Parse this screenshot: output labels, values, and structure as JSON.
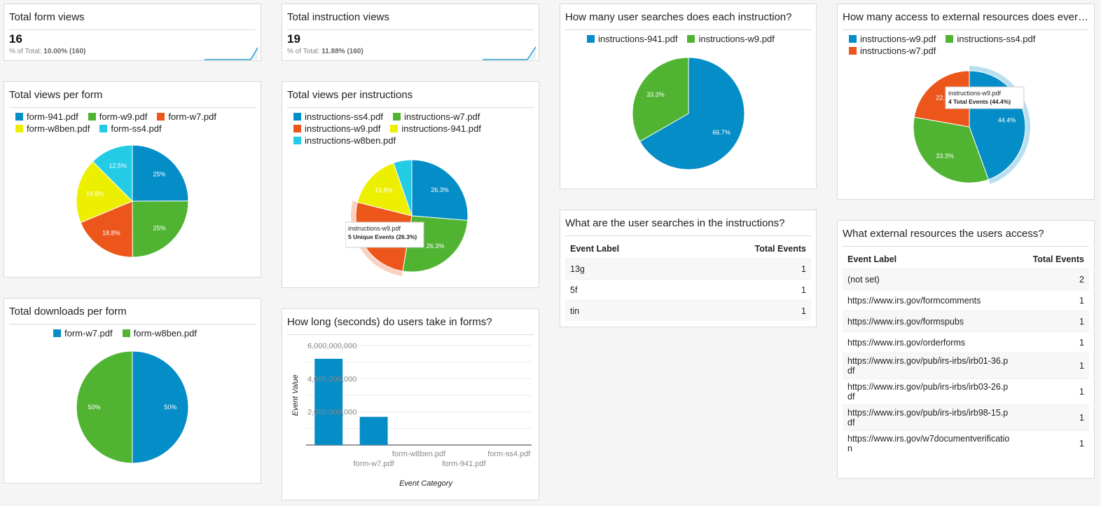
{
  "colors": {
    "blue": "#058dc7",
    "green": "#50b432",
    "orange": "#ed561b",
    "yellow": "#edef00",
    "cyan": "#24cbe5"
  },
  "cards": {
    "form_views": {
      "title": "Total form views",
      "value": "16",
      "pct_label": "% of Total:",
      "pct_value": "10.00% (160)"
    },
    "instruction_views": {
      "title": "Total instruction views",
      "value": "19",
      "pct_label": "% of Total:",
      "pct_value": "11.88% (160)"
    },
    "views_per_form": {
      "title": "Total views per form"
    },
    "views_per_instructions": {
      "title": "Total views per instructions"
    },
    "downloads_per_form": {
      "title": "Total downloads per form"
    },
    "time_in_forms": {
      "title": "How long (seconds) do users take in forms?"
    },
    "searches_per_instruction": {
      "title": "How many user searches does each instruction?"
    },
    "searches_table": {
      "title": "What are the user searches in the instructions?"
    },
    "external_per": {
      "title": "How many access to external resources does every..."
    },
    "external_table": {
      "title": "What external resources the users access?"
    }
  },
  "chart_data": [
    {
      "type": "pie",
      "id": "views_per_form",
      "series": [
        {
          "name": "form-941.pdf",
          "value": 25,
          "label": "25%",
          "color": "#058dc7"
        },
        {
          "name": "form-w9.pdf",
          "value": 25,
          "label": "25%",
          "color": "#50b432"
        },
        {
          "name": "form-w7.pdf",
          "value": 18.8,
          "label": "18.8%",
          "color": "#ed561b"
        },
        {
          "name": "form-w8ben.pdf",
          "value": 18.8,
          "label": "18.8%",
          "color": "#edef00"
        },
        {
          "name": "form-ss4.pdf",
          "value": 12.5,
          "label": "12.5%",
          "color": "#24cbe5"
        }
      ]
    },
    {
      "type": "pie",
      "id": "views_per_instructions",
      "series": [
        {
          "name": "instructions-ss4.pdf",
          "value": 26.3,
          "label": "26.3%",
          "color": "#058dc7"
        },
        {
          "name": "instructions-w7.pdf",
          "value": 26.3,
          "label": "26.3%",
          "color": "#50b432"
        },
        {
          "name": "instructions-w9.pdf",
          "value": 26.3,
          "label": "",
          "color": "#ed561b"
        },
        {
          "name": "instructions-941.pdf",
          "value": 15.8,
          "label": "15.8%",
          "color": "#edef00"
        },
        {
          "name": "instructions-w8ben.pdf",
          "value": 5.3,
          "label": "",
          "color": "#24cbe5"
        }
      ],
      "tooltip": {
        "title": "instructions-w9.pdf",
        "text": "5 Unique Events (26.3%)"
      }
    },
    {
      "type": "pie",
      "id": "downloads_per_form",
      "series": [
        {
          "name": "form-w7.pdf",
          "value": 50,
          "label": "50%",
          "color": "#058dc7"
        },
        {
          "name": "form-w8ben.pdf",
          "value": 50,
          "label": "50%",
          "color": "#50b432"
        }
      ]
    },
    {
      "type": "bar",
      "id": "time_in_forms",
      "categories": [
        "",
        "form-w7.pdf",
        "form-w8ben.pdf",
        "form-941.pdf",
        "form-ss4.pdf"
      ],
      "values": [
        5200000000,
        1700000000,
        0,
        0,
        0
      ],
      "ylim": [
        0,
        6000000000
      ],
      "yticks": [
        "2,000,000,000",
        "4,000,000,000",
        "6,000,000,000"
      ],
      "xlabel": "Event Category",
      "ylabel": "Event Value",
      "color": "#058dc7"
    },
    {
      "type": "pie",
      "id": "searches_per_instruction",
      "series": [
        {
          "name": "instructions-941.pdf",
          "value": 66.7,
          "label": "66.7%",
          "color": "#058dc7"
        },
        {
          "name": "instructions-w9.pdf",
          "value": 33.3,
          "label": "33.3%",
          "color": "#50b432"
        }
      ]
    },
    {
      "type": "pie",
      "id": "external_per",
      "series": [
        {
          "name": "instructions-w9.pdf",
          "value": 44.4,
          "label": "44.4%",
          "color": "#058dc7"
        },
        {
          "name": "instructions-ss4.pdf",
          "value": 33.3,
          "label": "33.3%",
          "color": "#50b432"
        },
        {
          "name": "instructions-w7.pdf",
          "value": 22.2,
          "label": "22.2%",
          "color": "#ed561b"
        }
      ],
      "tooltip": {
        "title": "instructions-w9.pdf",
        "text": "4 Total Events (44.4%)"
      }
    },
    {
      "type": "table",
      "id": "searches_table",
      "columns": [
        "Event Label",
        "Total Events"
      ],
      "rows": [
        [
          "13g",
          "1"
        ],
        [
          "5f",
          "1"
        ],
        [
          "tin",
          "1"
        ]
      ]
    },
    {
      "type": "table",
      "id": "external_table",
      "columns": [
        "Event Label",
        "Total Events"
      ],
      "rows": [
        [
          "(not set)",
          "2"
        ],
        [
          "https://www.irs.gov/formcomments",
          "1"
        ],
        [
          "https://www.irs.gov/formspubs",
          "1"
        ],
        [
          "https://www.irs.gov/orderforms",
          "1"
        ],
        [
          "https://www.irs.gov/pub/irs-irbs/irb01-36.pdf",
          "1"
        ],
        [
          "https://www.irs.gov/pub/irs-irbs/irb03-26.pdf",
          "1"
        ],
        [
          "https://www.irs.gov/pub/irs-irbs/irb98-15.pdf",
          "1"
        ],
        [
          "https://www.irs.gov/w7documentverification",
          "1"
        ]
      ]
    }
  ]
}
